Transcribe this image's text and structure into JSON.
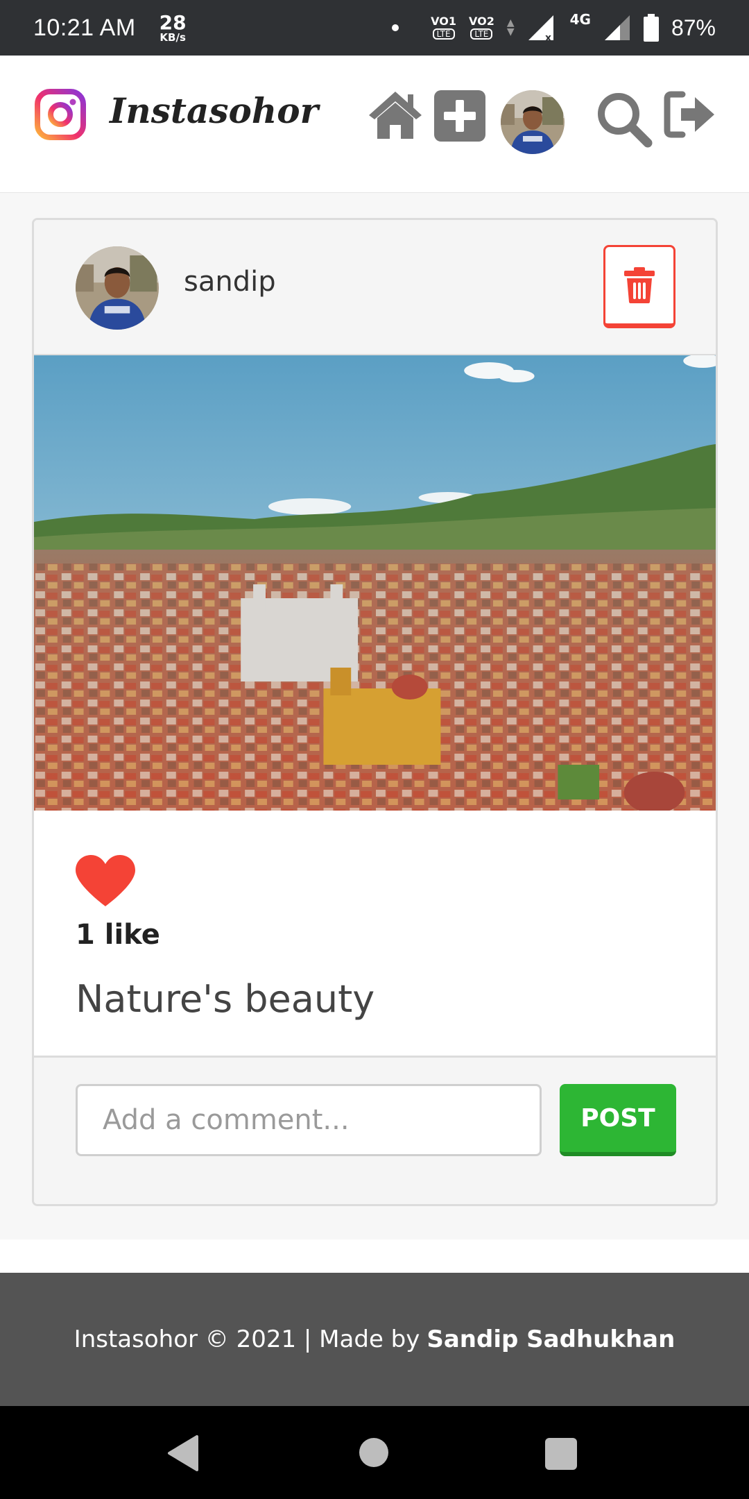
{
  "status_bar": {
    "time": "10:21 AM",
    "net_speed": "28",
    "net_unit": "KB/s",
    "sim1": "VO1",
    "sim2": "VO2",
    "lte": "LTE",
    "network": "4G",
    "battery": "87%"
  },
  "header": {
    "brand": "Instasohor",
    "icons": [
      "instagram-logo-icon",
      "home-icon",
      "add-post-icon",
      "profile-avatar",
      "search-icon",
      "logout-icon"
    ]
  },
  "post": {
    "author": "sandip",
    "likes_text": "1 like",
    "caption": "Nature's beauty",
    "liked": true
  },
  "comment": {
    "placeholder": "Add a comment...",
    "post_label": "POST"
  },
  "footer": {
    "text": "Instasohor © 2021 | Made by",
    "author": "Sandip Sadhukhan"
  },
  "colors": {
    "delete": "#f44336",
    "like": "#f44336",
    "post_button": "#2db634",
    "footer_bg": "#545454"
  }
}
